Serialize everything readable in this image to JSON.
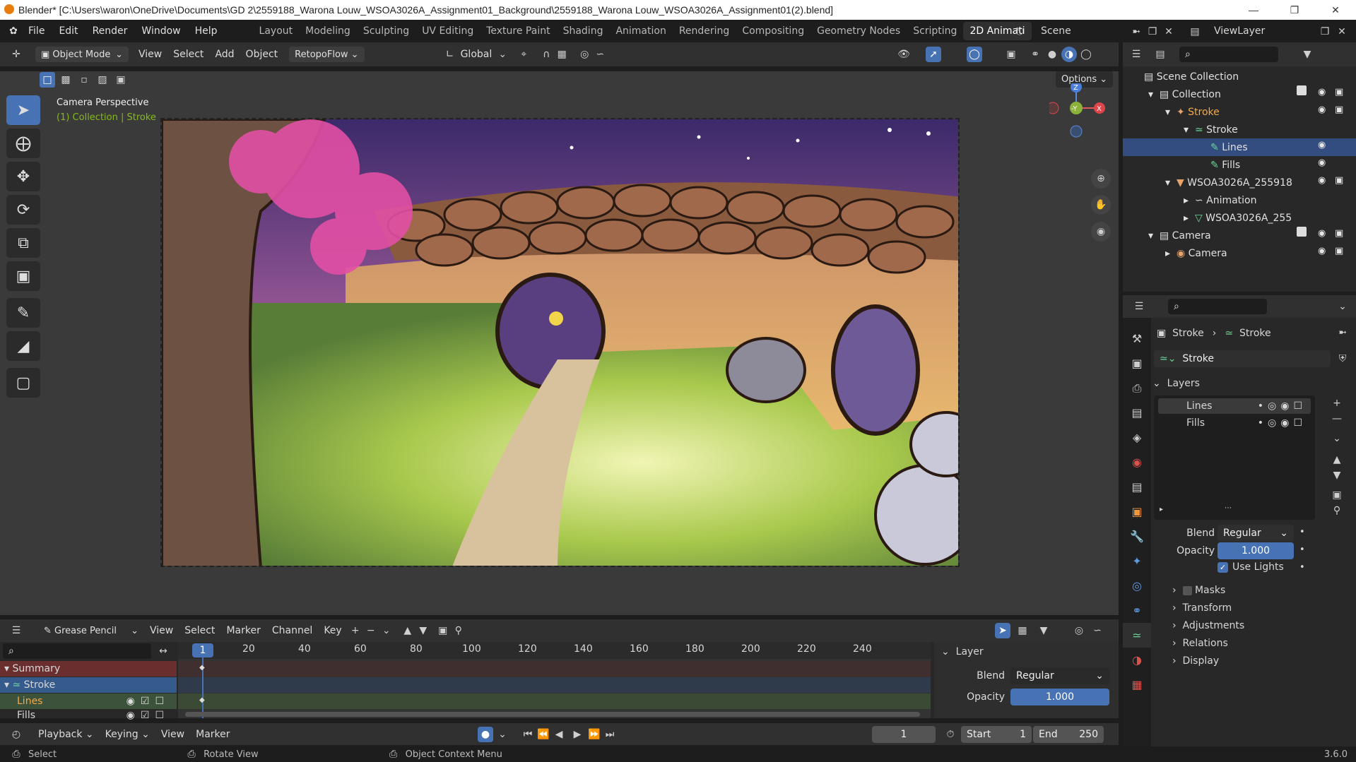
{
  "window": {
    "title": "Blender* [C:\\Users\\waron\\OneDrive\\Documents\\GD 2\\2559188_Warona Louw_WSOA3026A_Assignment01_Background\\2559188_Warona Louw_WSOA3026A_Assignment01(2).blend]"
  },
  "menu": {
    "items": [
      "File",
      "Edit",
      "Render",
      "Window",
      "Help"
    ]
  },
  "workspaces": {
    "tabs": [
      "Layout",
      "Modeling",
      "Sculpting",
      "UV Editing",
      "Texture Paint",
      "Shading",
      "Animation",
      "Rendering",
      "Compositing",
      "Geometry Nodes",
      "Scripting",
      "2D Animati"
    ],
    "active": "2D Animati"
  },
  "scene": {
    "name": "Scene",
    "view_layer": "ViewLayer"
  },
  "view3d": {
    "mode": "Object Mode",
    "menus": [
      "View",
      "Select",
      "Add",
      "Object"
    ],
    "addon": "RetopoFlow",
    "orientation": "Global",
    "options": "Options",
    "overlay_title": "Camera Perspective",
    "overlay_sub": "(1) Collection | Stroke",
    "gizmo": {
      "z": "Z",
      "y": "-Y",
      "x": "X"
    }
  },
  "outliner": {
    "rows": [
      {
        "label": "Scene Collection"
      },
      {
        "label": "Collection"
      },
      {
        "label": "Stroke"
      },
      {
        "label": "Stroke"
      },
      {
        "label": "Lines"
      },
      {
        "label": "Fills"
      },
      {
        "label": "WSOA3026A_255918"
      },
      {
        "label": "Animation"
      },
      {
        "label": "WSOA3026A_255"
      },
      {
        "label": "Camera"
      },
      {
        "label": "Camera"
      }
    ]
  },
  "properties": {
    "breadcrumb_obj": "Stroke",
    "breadcrumb_data": "Stroke",
    "datablock": "Stroke",
    "layers_header": "Layers",
    "layers": [
      "Lines",
      "Fills"
    ],
    "blend_label": "Blend",
    "blend_value": "Regular",
    "opacity_label": "Opacity",
    "opacity_value": "1.000",
    "use_lights": "Use Lights",
    "sections": [
      "Masks",
      "Transform",
      "Adjustments",
      "Relations",
      "Display"
    ]
  },
  "timeline": {
    "editor": "Grease Pencil",
    "menus": [
      "View",
      "Select",
      "Marker",
      "Channel",
      "Key"
    ],
    "current_frame": "1",
    "ticks": [
      "20",
      "40",
      "60",
      "80",
      "100",
      "120",
      "140",
      "160",
      "180",
      "200",
      "220",
      "240"
    ],
    "channels": [
      "Summary",
      "Stroke",
      "Lines",
      "Fills"
    ],
    "layer_panel": {
      "title": "Layer",
      "blend_label": "Blend",
      "blend_value": "Regular",
      "opacity_label": "Opacity",
      "opacity_value": "1.000"
    }
  },
  "playback": {
    "menus": [
      "Playback",
      "Keying",
      "View",
      "Marker"
    ],
    "frame": "1",
    "start_label": "Start",
    "start": "1",
    "end_label": "End",
    "end": "250"
  },
  "status": {
    "select": "Select",
    "rotate": "Rotate View",
    "context": "Object Context Menu",
    "version": "3.6.0"
  }
}
